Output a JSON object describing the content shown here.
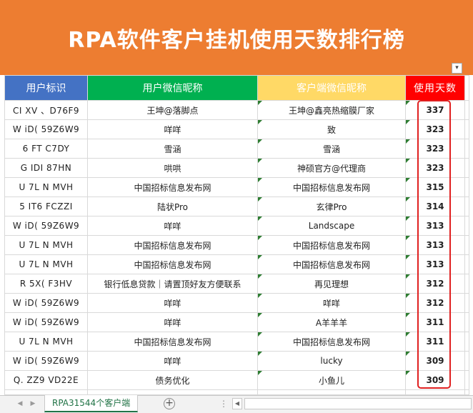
{
  "banner": {
    "title": "RPA软件客户挂机使用天数排行榜"
  },
  "headers": {
    "user_id": "用户标识",
    "wechat_name": "用户微信昵称",
    "client_name": "客户端微信昵称",
    "days": "使用天数"
  },
  "rows": [
    {
      "id": "CI XV 、D76F9",
      "wechat": "王坤@落脚点",
      "client": "王坤@鑫亮热缩膜厂家",
      "days": "337"
    },
    {
      "id": "W iD( 59Z6W9",
      "wechat": "咩咩",
      "client": "致",
      "days": "323"
    },
    {
      "id": "6 FT C7DY",
      "wechat": "雪涵",
      "client": "雪涵",
      "days": "323"
    },
    {
      "id": "G IDI 87HN",
      "wechat": "哄哄",
      "client": "神硕官方@代理商",
      "days": "323"
    },
    {
      "id": "U 7L N MVH",
      "wechat": "中国招标信息发布网",
      "client": "中国招标信息发布网",
      "days": "315"
    },
    {
      "id": "5 IT6 FCZZI",
      "wechat": "陆状Pro",
      "client": "玄律Pro",
      "days": "314"
    },
    {
      "id": "W iD( 59Z6W9",
      "wechat": "咩咩",
      "client": "Landscape",
      "days": "313"
    },
    {
      "id": "U 7L N MVH",
      "wechat": "中国招标信息发布网",
      "client": "中国招标信息发布网",
      "days": "313"
    },
    {
      "id": "U 7L N MVH",
      "wechat": "中国招标信息发布网",
      "client": "中国招标信息发布网",
      "days": "313"
    },
    {
      "id": "R 5X( F3HV",
      "wechat": "银行低息贷款｜请置顶好友方便联系",
      "client": "再见理想",
      "days": "312"
    },
    {
      "id": "W iD( 59Z6W9",
      "wechat": "咩咩",
      "client": "咩咩",
      "days": "312"
    },
    {
      "id": "W iD( 59Z6W9",
      "wechat": "咩咩",
      "client": "A羊羊羊",
      "days": "311"
    },
    {
      "id": "U 7L N MVH",
      "wechat": "中国招标信息发布网",
      "client": "中国招标信息发布网",
      "days": "311"
    },
    {
      "id": "W iD( 59Z6W9",
      "wechat": "咩咩",
      "client": "lucky",
      "days": "309"
    },
    {
      "id": "Q. ZZ9 VD22E",
      "wechat": "债务优化",
      "client": "小鱼儿",
      "days": "309"
    }
  ],
  "tabs": {
    "active": "RPA31544个客户端"
  },
  "icons": {
    "filter": "filter-dropdown-icon",
    "add_sheet": "plus-circle-icon",
    "prev": "caret-left-icon",
    "next": "caret-right-icon",
    "menu": "more-vertical-icon"
  },
  "colors": {
    "banner": "#ed7d31",
    "header_blue": "#4472c4",
    "header_green": "#00b050",
    "header_yellow": "#ffd966",
    "header_red": "#ff0000",
    "highlight": "#e02020"
  }
}
